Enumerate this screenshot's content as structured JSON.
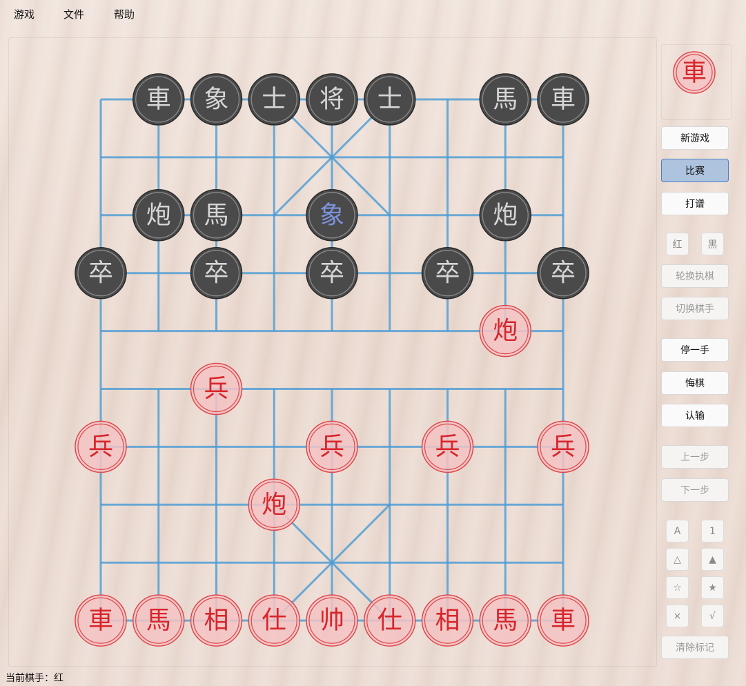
{
  "menu": {
    "game": "游戏",
    "file": "文件",
    "help": "帮助"
  },
  "current_turn_piece": "車",
  "buttons": {
    "new_game": "新游戏",
    "match": "比赛",
    "record": "打谱",
    "red": "红",
    "black": "黑",
    "swap_side": "轮换执棋",
    "switch_player": "切换棋手",
    "pass": "停一手",
    "undo": "悔棋",
    "resign": "认输",
    "prev_step": "上一步",
    "next_step": "下一步",
    "clear_marks": "清除标记"
  },
  "mark_buttons": [
    "A",
    "1",
    "△",
    "▲",
    "☆",
    "★",
    "×",
    "√"
  ],
  "status": {
    "label": "当前棋手：",
    "value": "红"
  },
  "board": {
    "line_color": "#4a9bd4",
    "pieces": [
      {
        "side": "black",
        "char": "車",
        "col": 1,
        "row": 0
      },
      {
        "side": "black",
        "char": "象",
        "col": 2,
        "row": 0
      },
      {
        "side": "black",
        "char": "士",
        "col": 3,
        "row": 0
      },
      {
        "side": "black",
        "char": "将",
        "col": 4,
        "row": 0
      },
      {
        "side": "black",
        "char": "士",
        "col": 5,
        "row": 0
      },
      {
        "side": "black",
        "char": "馬",
        "col": 7,
        "row": 0
      },
      {
        "side": "black",
        "char": "車",
        "col": 8,
        "row": 0
      },
      {
        "side": "black",
        "char": "炮",
        "col": 1,
        "row": 2
      },
      {
        "side": "black",
        "char": "馬",
        "col": 2,
        "row": 2
      },
      {
        "side": "black",
        "char": "象",
        "col": 4,
        "row": 2,
        "highlight": true
      },
      {
        "side": "black",
        "char": "炮",
        "col": 7,
        "row": 2
      },
      {
        "side": "black",
        "char": "卒",
        "col": 0,
        "row": 3
      },
      {
        "side": "black",
        "char": "卒",
        "col": 2,
        "row": 3
      },
      {
        "side": "black",
        "char": "卒",
        "col": 4,
        "row": 3
      },
      {
        "side": "black",
        "char": "卒",
        "col": 6,
        "row": 3
      },
      {
        "side": "black",
        "char": "卒",
        "col": 8,
        "row": 3
      },
      {
        "side": "red",
        "char": "炮",
        "col": 7,
        "row": 4
      },
      {
        "side": "red",
        "char": "兵",
        "col": 2,
        "row": 5
      },
      {
        "side": "red",
        "char": "兵",
        "col": 0,
        "row": 6
      },
      {
        "side": "red",
        "char": "兵",
        "col": 4,
        "row": 6
      },
      {
        "side": "red",
        "char": "兵",
        "col": 6,
        "row": 6
      },
      {
        "side": "red",
        "char": "兵",
        "col": 8,
        "row": 6
      },
      {
        "side": "red",
        "char": "炮",
        "col": 3,
        "row": 7
      },
      {
        "side": "red",
        "char": "車",
        "col": 0,
        "row": 9
      },
      {
        "side": "red",
        "char": "馬",
        "col": 1,
        "row": 9
      },
      {
        "side": "red",
        "char": "相",
        "col": 2,
        "row": 9
      },
      {
        "side": "red",
        "char": "仕",
        "col": 3,
        "row": 9
      },
      {
        "side": "red",
        "char": "帅",
        "col": 4,
        "row": 9
      },
      {
        "side": "red",
        "char": "仕",
        "col": 5,
        "row": 9
      },
      {
        "side": "red",
        "char": "相",
        "col": 6,
        "row": 9
      },
      {
        "side": "red",
        "char": "馬",
        "col": 7,
        "row": 9
      },
      {
        "side": "red",
        "char": "車",
        "col": 8,
        "row": 9
      }
    ]
  }
}
